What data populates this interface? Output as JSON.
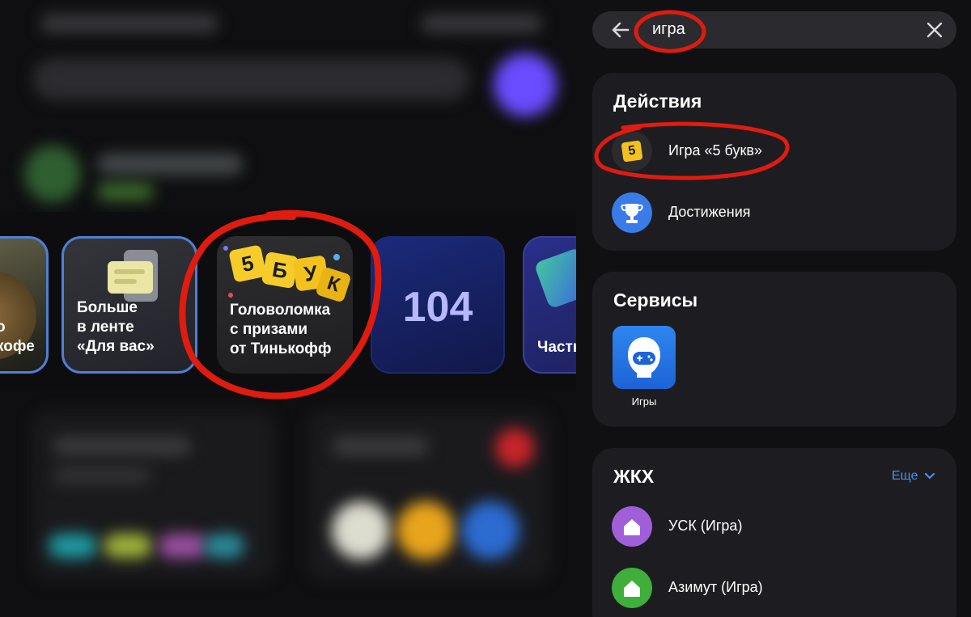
{
  "stories": [
    {
      "text": "о\nкофе",
      "ring": true
    },
    {
      "text": "Больше\nв ленте\n«Для вас»",
      "ring": true
    },
    {
      "text": "Головоломка\nс призами\nот Тинькофф",
      "ring": false,
      "tiles": [
        "5",
        "Б",
        "У",
        "К"
      ]
    },
    {
      "number": "104"
    },
    {
      "text": "Часть",
      "ring": false
    }
  ],
  "search": {
    "query": "игра",
    "back_icon": "arrow-left-icon",
    "clear_icon": "close-icon"
  },
  "actions": {
    "title": "Действия",
    "items": [
      {
        "label": "Игра «5 букв»",
        "icon": "five-letters-game-icon",
        "icon_text": "5"
      },
      {
        "label": "Достижения",
        "icon": "trophy-icon"
      }
    ]
  },
  "services": {
    "title": "Сервисы",
    "items": [
      {
        "label": "Игры",
        "icon": "gamepad-face-icon"
      }
    ]
  },
  "zhkh": {
    "title": "ЖКХ",
    "more_label": "Еще",
    "items": [
      {
        "label": "УСК (Игра)",
        "icon": "house-icon",
        "color": "#a05fd8"
      },
      {
        "label": "Азимут (Игра)",
        "icon": "house-icon",
        "color": "#3fae3a"
      }
    ]
  },
  "colors": {
    "accent_blue": "#4a8ef0",
    "annotation_red": "#e01b0f",
    "card_bg": "#1d1d21",
    "search_bg": "#2b2b2f"
  }
}
